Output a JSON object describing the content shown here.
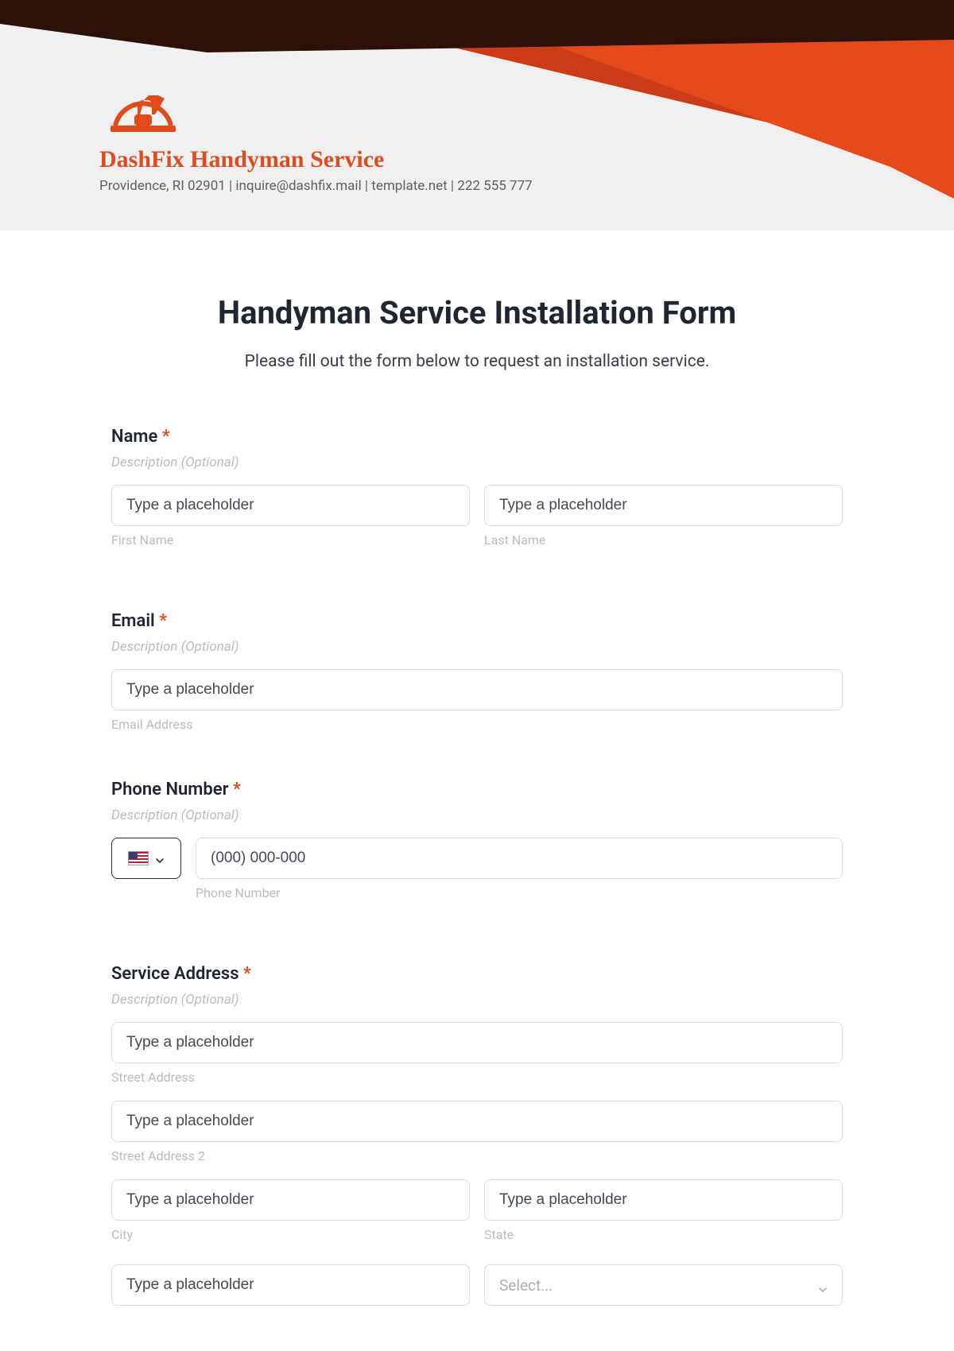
{
  "brand": {
    "name": "DashFix Handyman Service",
    "contact": "Providence, RI 02901 | inquire@dashfix.mail | template.net | 222 555 777"
  },
  "form": {
    "title": "Handyman Service Installation Form",
    "subtitle": "Please fill out the form below to request an installation service.",
    "required_mark": "*",
    "name": {
      "label": "Name",
      "description": "Description (Optional)",
      "first_placeholder": "Type a placeholder",
      "first_sublabel": "First Name",
      "last_placeholder": "Type a placeholder",
      "last_sublabel": "Last Name"
    },
    "email": {
      "label": "Email",
      "description": "Description (Optional)",
      "placeholder": "Type a placeholder",
      "sublabel": "Email Address"
    },
    "phone": {
      "label": "Phone Number",
      "description": "Description (Optional)",
      "placeholder": "(000) 000-000",
      "sublabel": "Phone Number",
      "country_selected": "US"
    },
    "address": {
      "label": "Service Address",
      "description": "Description (Optional)",
      "street1_placeholder": "Type a placeholder",
      "street1_sublabel": "Street Address",
      "street2_placeholder": "Type a placeholder",
      "street2_sublabel": "Street Address 2",
      "city_placeholder": "Type a placeholder",
      "city_sublabel": "City",
      "state_placeholder": "Type a placeholder",
      "state_sublabel": "State",
      "zip_placeholder": "Type a placeholder",
      "country_select_placeholder": "Select..."
    }
  },
  "colors": {
    "brand_orange": "#e14a1b",
    "dark_brown": "#2d1108"
  }
}
